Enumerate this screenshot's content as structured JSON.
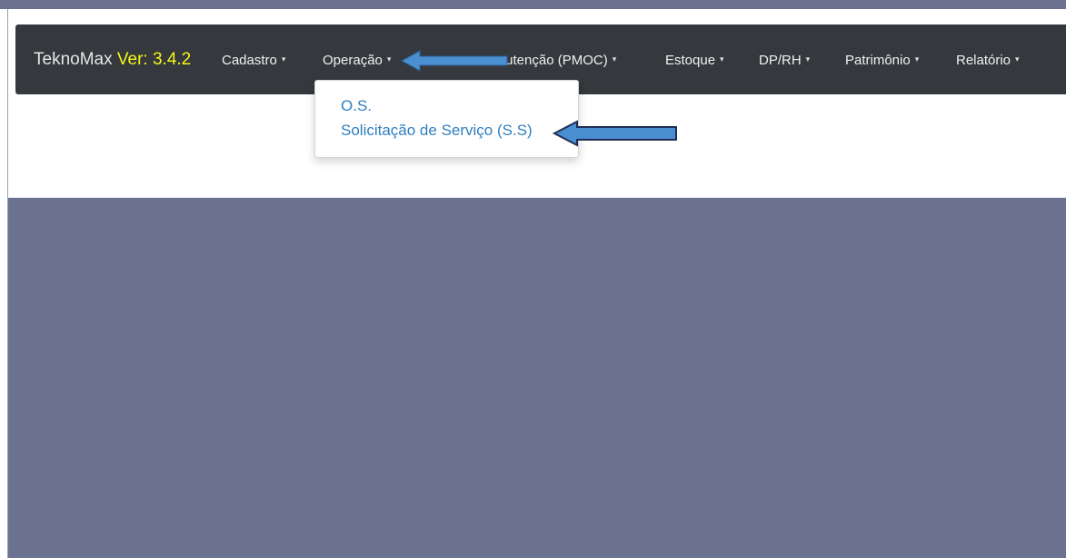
{
  "brand": {
    "name": "TeknoMax",
    "version_label": "Ver: 3.4.2"
  },
  "nav": {
    "items": [
      {
        "label": "Cadastro"
      },
      {
        "label": "Operação"
      },
      {
        "label": "ıutenção (PMOC)"
      },
      {
        "label": "Estoque"
      },
      {
        "label": "DP/RH"
      },
      {
        "label": "Patrimônio"
      },
      {
        "label": "Relatório"
      }
    ],
    "caret": "▾"
  },
  "dropdown": {
    "items": [
      {
        "label": "O.S."
      },
      {
        "label": "Solicitação de Serviço (S.S)"
      }
    ]
  },
  "colors": {
    "navbar_bg": "#35393d",
    "version_accent": "#f5f51a",
    "link": "#2f7fbf",
    "content_bg": "#6b7290",
    "annotation_arrow": "#4a8fd0"
  },
  "annotations": {
    "icons": [
      "left-arrow-icon",
      "left-arrow-icon"
    ]
  }
}
